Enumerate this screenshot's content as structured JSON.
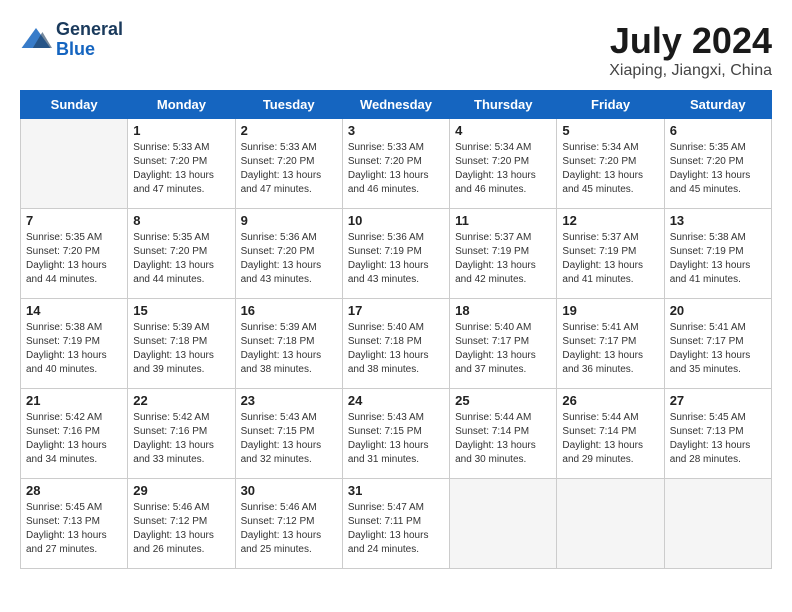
{
  "header": {
    "logo_line1": "General",
    "logo_line2": "Blue",
    "month_year": "July 2024",
    "location": "Xiaping, Jiangxi, China"
  },
  "weekdays": [
    "Sunday",
    "Monday",
    "Tuesday",
    "Wednesday",
    "Thursday",
    "Friday",
    "Saturday"
  ],
  "weeks": [
    [
      {
        "day": "",
        "info": ""
      },
      {
        "day": "1",
        "info": "Sunrise: 5:33 AM\nSunset: 7:20 PM\nDaylight: 13 hours\nand 47 minutes."
      },
      {
        "day": "2",
        "info": "Sunrise: 5:33 AM\nSunset: 7:20 PM\nDaylight: 13 hours\nand 47 minutes."
      },
      {
        "day": "3",
        "info": "Sunrise: 5:33 AM\nSunset: 7:20 PM\nDaylight: 13 hours\nand 46 minutes."
      },
      {
        "day": "4",
        "info": "Sunrise: 5:34 AM\nSunset: 7:20 PM\nDaylight: 13 hours\nand 46 minutes."
      },
      {
        "day": "5",
        "info": "Sunrise: 5:34 AM\nSunset: 7:20 PM\nDaylight: 13 hours\nand 45 minutes."
      },
      {
        "day": "6",
        "info": "Sunrise: 5:35 AM\nSunset: 7:20 PM\nDaylight: 13 hours\nand 45 minutes."
      }
    ],
    [
      {
        "day": "7",
        "info": "Sunrise: 5:35 AM\nSunset: 7:20 PM\nDaylight: 13 hours\nand 44 minutes."
      },
      {
        "day": "8",
        "info": "Sunrise: 5:35 AM\nSunset: 7:20 PM\nDaylight: 13 hours\nand 44 minutes."
      },
      {
        "day": "9",
        "info": "Sunrise: 5:36 AM\nSunset: 7:20 PM\nDaylight: 13 hours\nand 43 minutes."
      },
      {
        "day": "10",
        "info": "Sunrise: 5:36 AM\nSunset: 7:19 PM\nDaylight: 13 hours\nand 43 minutes."
      },
      {
        "day": "11",
        "info": "Sunrise: 5:37 AM\nSunset: 7:19 PM\nDaylight: 13 hours\nand 42 minutes."
      },
      {
        "day": "12",
        "info": "Sunrise: 5:37 AM\nSunset: 7:19 PM\nDaylight: 13 hours\nand 41 minutes."
      },
      {
        "day": "13",
        "info": "Sunrise: 5:38 AM\nSunset: 7:19 PM\nDaylight: 13 hours\nand 41 minutes."
      }
    ],
    [
      {
        "day": "14",
        "info": "Sunrise: 5:38 AM\nSunset: 7:19 PM\nDaylight: 13 hours\nand 40 minutes."
      },
      {
        "day": "15",
        "info": "Sunrise: 5:39 AM\nSunset: 7:18 PM\nDaylight: 13 hours\nand 39 minutes."
      },
      {
        "day": "16",
        "info": "Sunrise: 5:39 AM\nSunset: 7:18 PM\nDaylight: 13 hours\nand 38 minutes."
      },
      {
        "day": "17",
        "info": "Sunrise: 5:40 AM\nSunset: 7:18 PM\nDaylight: 13 hours\nand 38 minutes."
      },
      {
        "day": "18",
        "info": "Sunrise: 5:40 AM\nSunset: 7:17 PM\nDaylight: 13 hours\nand 37 minutes."
      },
      {
        "day": "19",
        "info": "Sunrise: 5:41 AM\nSunset: 7:17 PM\nDaylight: 13 hours\nand 36 minutes."
      },
      {
        "day": "20",
        "info": "Sunrise: 5:41 AM\nSunset: 7:17 PM\nDaylight: 13 hours\nand 35 minutes."
      }
    ],
    [
      {
        "day": "21",
        "info": "Sunrise: 5:42 AM\nSunset: 7:16 PM\nDaylight: 13 hours\nand 34 minutes."
      },
      {
        "day": "22",
        "info": "Sunrise: 5:42 AM\nSunset: 7:16 PM\nDaylight: 13 hours\nand 33 minutes."
      },
      {
        "day": "23",
        "info": "Sunrise: 5:43 AM\nSunset: 7:15 PM\nDaylight: 13 hours\nand 32 minutes."
      },
      {
        "day": "24",
        "info": "Sunrise: 5:43 AM\nSunset: 7:15 PM\nDaylight: 13 hours\nand 31 minutes."
      },
      {
        "day": "25",
        "info": "Sunrise: 5:44 AM\nSunset: 7:14 PM\nDaylight: 13 hours\nand 30 minutes."
      },
      {
        "day": "26",
        "info": "Sunrise: 5:44 AM\nSunset: 7:14 PM\nDaylight: 13 hours\nand 29 minutes."
      },
      {
        "day": "27",
        "info": "Sunrise: 5:45 AM\nSunset: 7:13 PM\nDaylight: 13 hours\nand 28 minutes."
      }
    ],
    [
      {
        "day": "28",
        "info": "Sunrise: 5:45 AM\nSunset: 7:13 PM\nDaylight: 13 hours\nand 27 minutes."
      },
      {
        "day": "29",
        "info": "Sunrise: 5:46 AM\nSunset: 7:12 PM\nDaylight: 13 hours\nand 26 minutes."
      },
      {
        "day": "30",
        "info": "Sunrise: 5:46 AM\nSunset: 7:12 PM\nDaylight: 13 hours\nand 25 minutes."
      },
      {
        "day": "31",
        "info": "Sunrise: 5:47 AM\nSunset: 7:11 PM\nDaylight: 13 hours\nand 24 minutes."
      },
      {
        "day": "",
        "info": ""
      },
      {
        "day": "",
        "info": ""
      },
      {
        "day": "",
        "info": ""
      }
    ]
  ]
}
